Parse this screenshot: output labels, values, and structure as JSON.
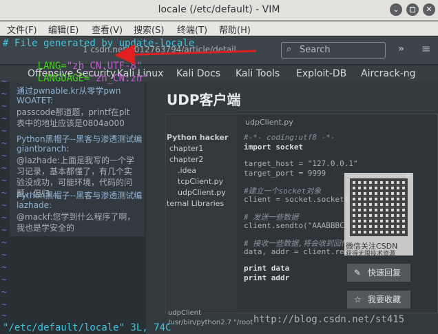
{
  "window": {
    "title": "locale (/etc/default) - VIM",
    "minimize_glyph": "⌄",
    "close_glyph": "✕"
  },
  "menu": {
    "items": [
      "文件(F)",
      "编辑(E)",
      "查看(V)",
      "搜索(S)",
      "终端(T)",
      "帮助(H)"
    ]
  },
  "vim": {
    "line1": "# File generated by update-locale",
    "line2_key": "LANG=",
    "line2_val": "\"zh_CN.UTF-8\"",
    "line3_key": "LANGUAGE=",
    "line3_val": "\"zh_CN:zh\"",
    "tilde": "~",
    "status": "\"/etc/default/locale\" 3L, 74C"
  },
  "background_browser": {
    "url_fragment": "1 csdn.net/u012763794/article/detail",
    "search_placeholder": "Search",
    "bookmarks": [
      "Offensive Security",
      "Kali Linux",
      "Kali Docs",
      "Kali Tools",
      "Exploit-DB",
      "Aircrack-ng"
    ],
    "sidebar": [
      {
        "title": "通过pwnable.kr从零学pwn",
        "author": "WOATET:",
        "body": "passcode那道题，printf在plt表中的地址应该是0804a000"
      },
      {
        "title": "Python黑帽子--黑客与渗透测试编",
        "author": "giantbranch:",
        "body": "@lazhade:上面是我写的一个学习记录，基本都懂了，有几个实验没成功，可能环境，代码的问题，但归..."
      },
      {
        "title": "Python黑帽子--黑客与渗透测试编",
        "author": "lazhade:",
        "body": "@mackf:您学到什么程序了啊，我也是学安全的"
      }
    ],
    "article_title": "UDP客户端",
    "ide_tab": "udpClient.py",
    "project_tree": [
      "Python hacker",
      "chapter1",
      "chapter2",
      ".idea",
      "tcpClient.py",
      "udpClient.py",
      "ternal Libraries"
    ],
    "code": [
      "#-*- coding:utf8 -*-",
      "import socket",
      "",
      "target_host = \"127.0.0.1\"",
      "target_port = 9999",
      "",
      "#建立一个socket对象",
      "client = socket.socket(",
      "",
      "# 发送一些数据",
      "client.sendto(\"AAABBBC",
      "",
      "# 接收一些数据,将会收到回传",
      "data, addr = client.rec",
      "",
      "print data",
      "print addr"
    ],
    "qr_caption": "微信关注CSDN",
    "qr_sub": "获得无限技术资源",
    "reply_btn": "快速回复",
    "fav_btn": "我要收藏",
    "bottom_tab": "udpClient",
    "bottom_path": "/usr/bin/python2.7 \"/root",
    "watermark": "http://blog.csdn.net/st415"
  },
  "colors": {
    "comment": "#3ec6e0",
    "key": "#46d11a",
    "string": "#c85ad6",
    "tilde": "#5a78d8",
    "arrow": "#e02020"
  }
}
